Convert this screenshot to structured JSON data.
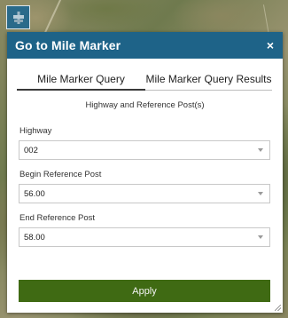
{
  "map": {
    "tool_icon": "road-marker-icon"
  },
  "panel": {
    "title": "Go to Mile Marker",
    "close_label": "×",
    "header_color": "#1e6388",
    "tabs": [
      {
        "label": "Mile Marker Query",
        "active": true
      },
      {
        "label": "Mile Marker Query Results",
        "active": false
      }
    ],
    "subtitle": "Highway and Reference Post(s)",
    "fields": {
      "highway": {
        "label": "Highway",
        "value": "002"
      },
      "begin_ref": {
        "label": "Begin Reference Post",
        "value": "56.00"
      },
      "end_ref": {
        "label": "End Reference Post",
        "value": "58.00"
      }
    },
    "apply_label": "Apply",
    "apply_color": "#3f6a13"
  }
}
